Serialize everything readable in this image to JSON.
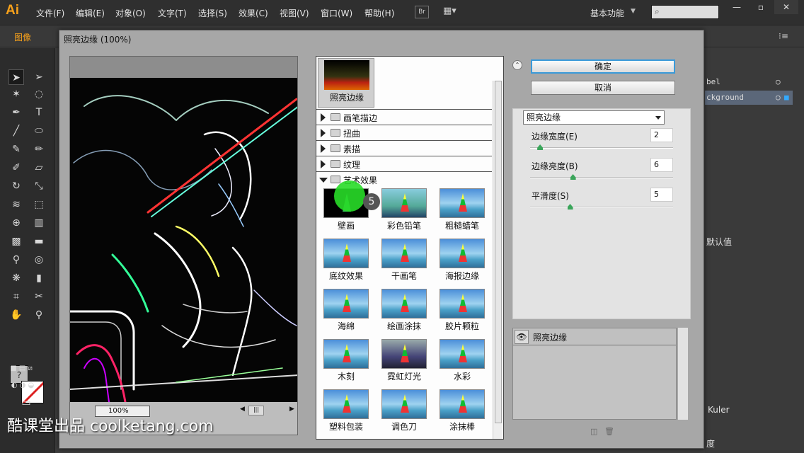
{
  "app": {
    "logo": "Ai",
    "menus": [
      "文件(F)",
      "编辑(E)",
      "对象(O)",
      "文字(T)",
      "选择(S)",
      "效果(C)",
      "视图(V)",
      "窗口(W)",
      "帮助(H)"
    ],
    "bridge": "Br",
    "workspace": "基本功能",
    "control_label": "图像"
  },
  "right_panel": {
    "layer_rows": [
      "bel",
      "ckground"
    ],
    "preset_text": "默认值",
    "kuler": "Kuler",
    "bottom_text": "度"
  },
  "dialog": {
    "title": "照亮边缘 (100%)",
    "zoom": "100%",
    "ok_label": "确定",
    "cancel_label": "取消",
    "filter_select": "照亮边缘",
    "params": [
      {
        "label": "边缘宽度(E)",
        "value": "2",
        "fraction": 0.07
      },
      {
        "label": "边缘亮度(B)",
        "value": "6",
        "fraction": 0.3
      },
      {
        "label": "平滑度(S)",
        "value": "5",
        "fraction": 0.28
      }
    ],
    "effect_layer": "照亮边缘"
  },
  "gallery": {
    "current": "照亮边缘",
    "categories": [
      {
        "name": "画笔描边",
        "open": false
      },
      {
        "name": "扭曲",
        "open": false
      },
      {
        "name": "素描",
        "open": false
      },
      {
        "name": "纹理",
        "open": false
      },
      {
        "name": "艺术效果",
        "open": true
      }
    ],
    "thumbnails": [
      "壁画",
      "彩色铅笔",
      "粗糙蜡笔",
      "底纹效果",
      "干画笔",
      "海报边缘",
      "海绵",
      "绘画涂抹",
      "胶片颗粒",
      "木刻",
      "霓虹灯光",
      "水彩",
      "塑料包装",
      "调色刀",
      "涂抹棒"
    ],
    "badge": "5"
  },
  "watermark": "酷课堂出品 coolketang.com",
  "colors": {
    "accent": "#f7a11b",
    "primary_button_border": "#3a9ad9",
    "highlight": "#28dc28"
  }
}
